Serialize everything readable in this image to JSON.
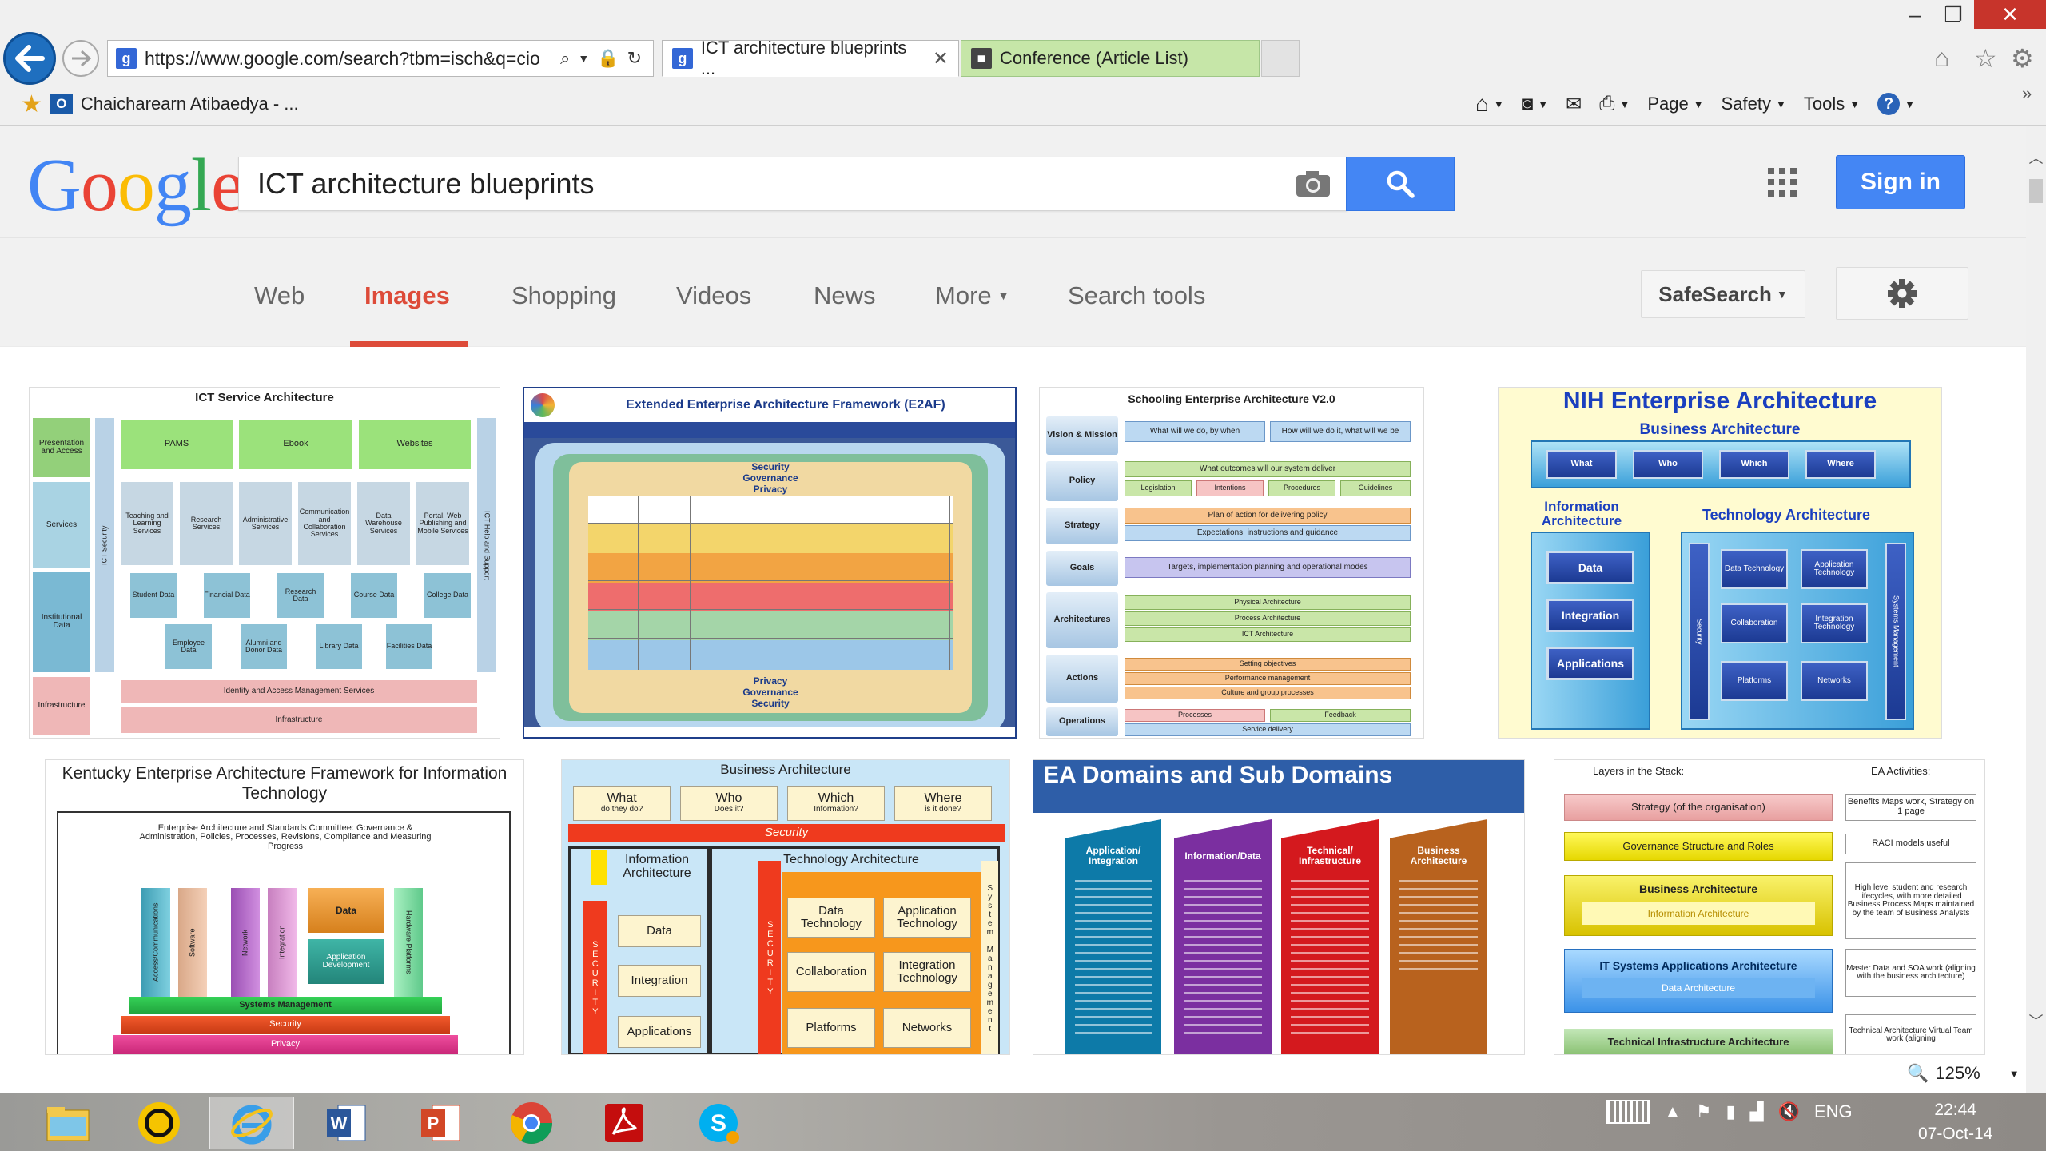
{
  "window": {
    "minimize": "–",
    "restore": "❐",
    "close": "✕"
  },
  "browser": {
    "url": "https://www.google.com/search?tbm=isch&q=cio",
    "tabs": [
      {
        "label": "ICT architecture blueprints ...",
        "close": "✕"
      },
      {
        "label": "Conference (Article List)"
      }
    ],
    "favorites_link": "Chaicharearn Atibaedya - ...",
    "commands": [
      "Page",
      "Safety",
      "Tools"
    ],
    "zoom": "125%"
  },
  "google": {
    "logo": "Google",
    "query": "ICT architecture blueprints",
    "sign_in": "Sign in",
    "nav": {
      "web": "Web",
      "images": "Images",
      "shopping": "Shopping",
      "videos": "Videos",
      "news": "News",
      "more": "More",
      "search_tools": "Search tools"
    },
    "safesearch": "SafeSearch"
  },
  "results": [
    {
      "title": "ICT Service Architecture",
      "top_boxes": [
        "PAMS",
        "Ebook",
        "Websites"
      ],
      "side": [
        "Presentation and Access",
        "Services",
        "Institutional Data",
        "Infrastructure"
      ],
      "services": [
        "Teaching and Learning Services",
        "Research Services",
        "Administrative Services",
        "Communication and Collaboration Services",
        "Data Warehouse Services",
        "Portal, Web Publishing and Mobile Services"
      ],
      "data_row1": [
        "Student Data",
        "Financial Data",
        "Research Data",
        "Course Data",
        "College Data"
      ],
      "data_row2": [
        "Employee Data",
        "Alumni and Donor Data",
        "Library Data",
        "Facilities Data"
      ],
      "identity": "Identity and Access Management Services",
      "infra": "Infrastructure",
      "security": "ICT Security",
      "help": "ICT Help and Support"
    },
    {
      "title": "Extended Enterprise Architecture Framework (E2AF)",
      "bands": [
        "Security",
        "Governance",
        "Privacy"
      ]
    },
    {
      "title": "Schooling Enterprise Architecture V2.0",
      "rows": [
        {
          "label": "Vision & Mission",
          "items": [
            "What will we do, by when",
            "How will we do it, what will we be"
          ]
        },
        {
          "label": "Policy",
          "items": [
            "What outcomes will our system deliver",
            "Legislation",
            "Intentions",
            "Procedures",
            "Guidelines"
          ]
        },
        {
          "label": "Strategy",
          "items": [
            "Plan of action for delivering policy",
            "Expectations, instructions and guidance"
          ]
        },
        {
          "label": "Goals",
          "items": [
            "Targets, implementation planning and operational modes"
          ]
        },
        {
          "label": "Architectures",
          "items": [
            "Physical Architecture",
            "Process Architecture",
            "ICT Architecture"
          ]
        },
        {
          "label": "Actions",
          "items": [
            "Setting objectives",
            "Performance management",
            "Culture and group processes"
          ]
        },
        {
          "label": "Operations",
          "items": [
            "Processes",
            "Feedback",
            "Service delivery"
          ]
        }
      ]
    },
    {
      "title": "NIH Enterprise Architecture",
      "business": "Business Architecture",
      "business_items": [
        "What",
        "Who",
        "Which",
        "Where"
      ],
      "info": "Information Architecture",
      "info_items": [
        "Data",
        "Integration",
        "Applications"
      ],
      "tech": "Technology Architecture",
      "tech_items": [
        "Data Technology",
        "Application Technology",
        "Collaboration",
        "Integration Technology",
        "Platforms",
        "Networks"
      ],
      "security": "Security",
      "systems": "Systems Management"
    },
    {
      "title": "Kentucky Enterprise Architecture Framework for Information Technology",
      "committee": "Enterprise Architecture and Standards Committee: Governance & Administration, Policies, Processes, Revisions, Compliance and Measuring Progress",
      "columns": [
        "Access/Communications",
        "Software",
        "Network",
        "Integration"
      ],
      "data": "Data",
      "app_dev": "Application Development",
      "hw": "Hardware Platforms",
      "sysmgmt": "Systems Management",
      "security": "Security",
      "privacy": "Privacy"
    },
    {
      "title": "Business Architecture",
      "top": [
        {
          "a": "What",
          "b": "do they do?"
        },
        {
          "a": "Who",
          "b": "Does it?"
        },
        {
          "a": "Which",
          "b": "Information?"
        },
        {
          "a": "Where",
          "b": "is it done?"
        }
      ],
      "security": "Security",
      "security_v": "SECURITY",
      "info": "Information Architecture",
      "info_items": [
        "Data",
        "Integration",
        "Applications"
      ],
      "tech": "Technology Architecture",
      "tech_items": [
        "Data Technology",
        "Application Technology",
        "Collaboration",
        "Integration Technology",
        "Platforms",
        "Networks"
      ],
      "systems": "System Management"
    },
    {
      "title": "EA Domains and Sub Domains",
      "domains": [
        "Application/ Integration",
        "Information/Data",
        "Technical/ Infrastructure",
        "Business Architecture"
      ]
    },
    {
      "header_left": "Layers in the Stack:",
      "header_right": "EA Activities:",
      "layers": [
        "Strategy (of the organisation)",
        "Governance Structure and Roles",
        "Business Architecture",
        "Information Architecture",
        "IT Systems Applications Architecture",
        "Data Architecture",
        "Technical Infrastructure Architecture"
      ],
      "activities": [
        "Benefits Maps work, Strategy on 1 page",
        "RACI models useful",
        "High level student and research lifecycles, with more detailed Business Process Maps maintained by the team of Business Analysts",
        "Master Data and SOA work (aligning with the business architecture)",
        "Technical Architecture Virtual Team work (aligning"
      ]
    }
  ],
  "taskbar": {
    "lang": "ENG",
    "time": "22:44",
    "date": "07-Oct-14"
  },
  "colors": {
    "google_blue": "#4486f4",
    "images_red": "#dd4b39",
    "ie_blue": "#1f6fbf"
  }
}
